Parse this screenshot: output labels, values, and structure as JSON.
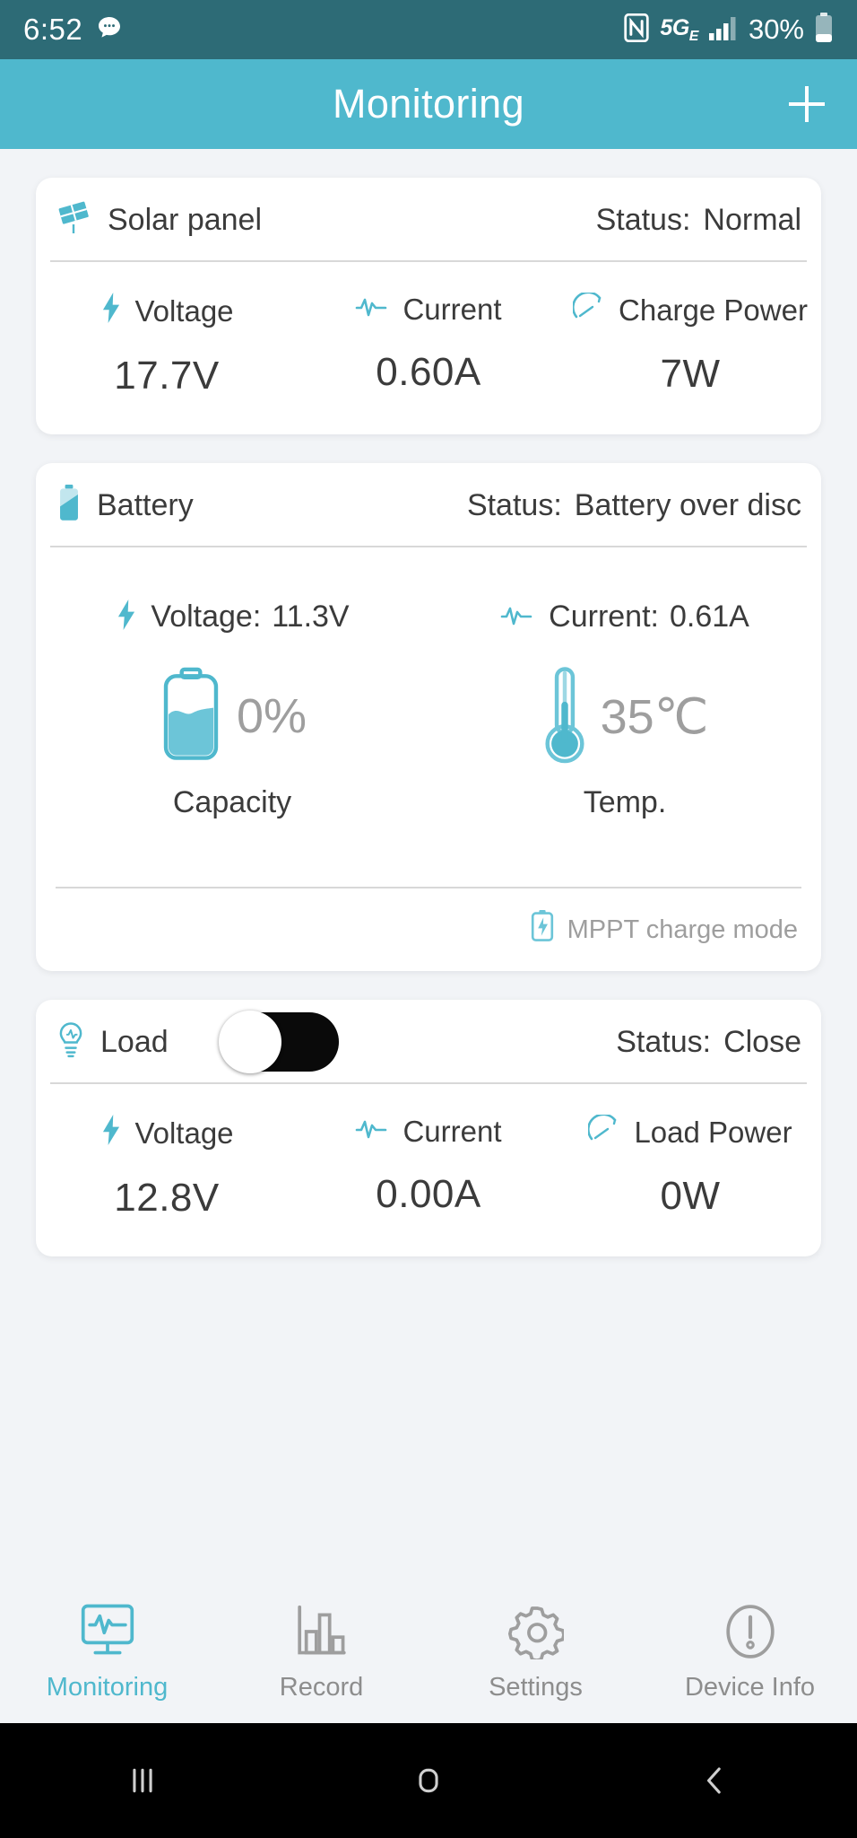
{
  "status_bar": {
    "time": "6:52",
    "message_icon": "message-bubble-icon",
    "nfc_icon": "nfc-icon",
    "network_label": "5G",
    "network_sub": "E",
    "signal_icon": "signal-bars-icon",
    "battery_percent": "30%",
    "battery_icon": "battery-icon"
  },
  "app_bar": {
    "title": "Monitoring",
    "add_label": "+"
  },
  "solar": {
    "icon": "solar-panel-icon",
    "title": "Solar panel",
    "status_label": "Status:",
    "status_value": "Normal",
    "metrics": [
      {
        "icon": "bolt-icon",
        "label": "Voltage",
        "value": "17.7V"
      },
      {
        "icon": "waveform-icon",
        "label": "Current",
        "value": "0.60A"
      },
      {
        "icon": "gauge-icon",
        "label": "Charge Power",
        "value": "7W"
      }
    ]
  },
  "battery": {
    "icon": "battery-vertical-icon",
    "title": "Battery",
    "status_label": "Status:",
    "status_value": "Battery over disc",
    "voltage_icon": "bolt-icon",
    "voltage_label": "Voltage:",
    "voltage_value": "11.3V",
    "current_icon": "waveform-icon",
    "current_label": "Current:",
    "current_value": "0.61A",
    "capacity_icon": "battery-level-icon",
    "capacity_value": "0%",
    "capacity_caption": "Capacity",
    "temp_icon": "thermometer-icon",
    "temp_value": "35℃",
    "temp_caption": "Temp.",
    "mode_icon": "battery-charge-icon",
    "mode_label": "MPPT charge mode"
  },
  "load": {
    "icon": "lightbulb-icon",
    "title": "Load",
    "toggle_state": "off",
    "status_label": "Status:",
    "status_value": "Close",
    "metrics": [
      {
        "icon": "bolt-icon",
        "label": "Voltage",
        "value": "12.8V"
      },
      {
        "icon": "waveform-icon",
        "label": "Current",
        "value": "0.00A"
      },
      {
        "icon": "gauge-icon",
        "label": "Load Power",
        "value": "0W"
      }
    ]
  },
  "bottom_nav": {
    "items": [
      {
        "icon": "monitor-waveform-icon",
        "label": "Monitoring",
        "active": true
      },
      {
        "icon": "bar-chart-icon",
        "label": "Record",
        "active": false
      },
      {
        "icon": "gear-icon",
        "label": "Settings",
        "active": false
      },
      {
        "icon": "exclamation-oval-icon",
        "label": "Device Info",
        "active": false
      }
    ]
  },
  "android_nav": {
    "recents_icon": "recents-icon",
    "home_icon": "home-icon",
    "back_icon": "back-icon"
  },
  "colors": {
    "accent": "#4fb8cd",
    "status_bar": "#2d6b76",
    "page_bg": "#f2f4f7",
    "text": "#3b3b3b",
    "muted": "#9e9e9e"
  }
}
